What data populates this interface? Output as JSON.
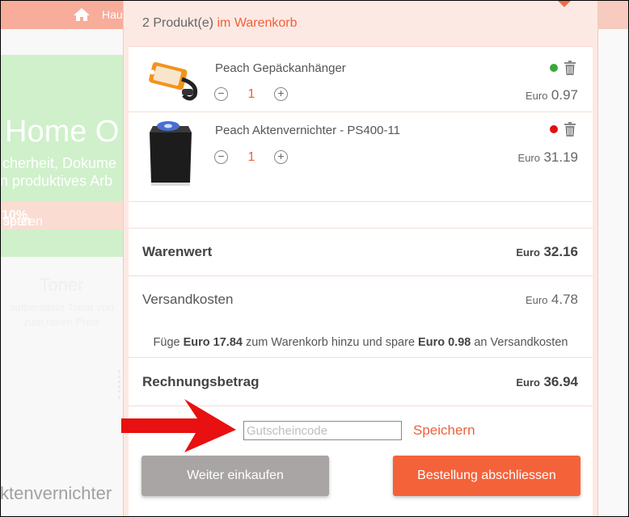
{
  "background": {
    "nav_home_label": "Hau",
    "hero_title": "Home O",
    "hero_line1": "cherheit, Dokume",
    "hero_line2": "n produktives Arb",
    "hero_strip_prefix": "Jetzt ",
    "hero_strip_bold": "10%",
    "hero_strip_suffix": " sparen",
    "toner_title": "Toner",
    "toner_line1": "aufbereitete Toner von",
    "toner_line2": "zum fairen Preis",
    "bottom_heading": "ktenvernichter"
  },
  "cart": {
    "count_text": "2 Produkt(e)",
    "count_highlight": "im Warenkorb",
    "currency": "Euro",
    "items": [
      {
        "name": "Peach Gepäckanhänger",
        "qty": "1",
        "price": "0.97",
        "status_color": "#3aa83a"
      },
      {
        "name": "Peach Aktenvernichter - PS400-11",
        "qty": "1",
        "price": "31.19",
        "status_color": "#e01010"
      }
    ],
    "minus_symbol": "−",
    "plus_symbol": "+",
    "subtotal_label": "Warenwert",
    "subtotal_value": "32.16",
    "shipping_label": "Versandkosten",
    "shipping_value": "4.78",
    "shipping_note": {
      "part1": "Füge ",
      "amount": "Euro 17.84",
      "part2": " zum Warenkorb hinzu und spare ",
      "saving": "Euro 0.98",
      "part3": " an Versandkosten"
    },
    "total_label": "Rechnungsbetrag",
    "total_value": "36.94",
    "coupon_placeholder": "Gutscheincode",
    "coupon_value": "",
    "save_label": "Speichern",
    "continue_label": "Weiter einkaufen",
    "order_label": "Bestellung abschliessen"
  },
  "colors": {
    "accent": "#f0603a",
    "nav": "#f06a48",
    "panel_tint": "#fde9e3",
    "continue_button": "#a9a5a5",
    "order_button": "#f4623a",
    "arrow": "#e81010"
  },
  "icons": {
    "home": "home-icon",
    "trash": "trash-icon",
    "minus": "minus-circle-icon",
    "plus": "plus-circle-icon",
    "arrow": "red-arrow-icon"
  }
}
